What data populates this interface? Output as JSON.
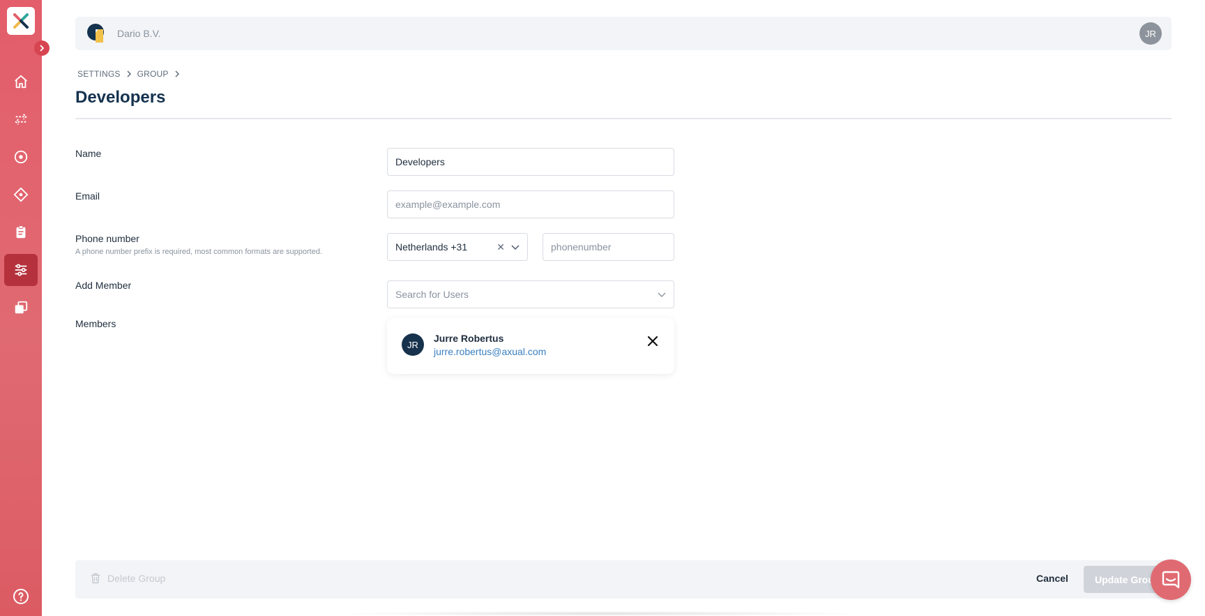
{
  "org": {
    "name": "Dario B.V."
  },
  "user": {
    "initials": "JR"
  },
  "sidebar": {
    "items": [
      {
        "icon": "home-icon",
        "active": false
      },
      {
        "icon": "transfer-icon",
        "active": false
      },
      {
        "icon": "target-icon",
        "active": false
      },
      {
        "icon": "diamond-icon",
        "active": false
      },
      {
        "icon": "clipboard-icon",
        "active": false
      },
      {
        "icon": "settings-sliders-icon",
        "active": true
      },
      {
        "icon": "copy-icon",
        "active": false
      }
    ]
  },
  "breadcrumb": [
    "SETTINGS",
    "GROUP"
  ],
  "page": {
    "title": "Developers"
  },
  "form": {
    "name_label": "Name",
    "name_value": "Developers",
    "email_label": "Email",
    "email_placeholder": "example@example.com",
    "email_value": "",
    "phone_label": "Phone number",
    "phone_hint": "A phone number prefix is required, most common formats are supported.",
    "phone_country": "Netherlands +31",
    "phone_placeholder": "phonenumber",
    "add_member_label": "Add Member",
    "add_member_placeholder": "Search for Users",
    "members_label": "Members"
  },
  "members": [
    {
      "initials": "JR",
      "name": "Jurre Robertus",
      "email": "jurre.robertus@axual.com"
    }
  ],
  "footer": {
    "delete_label": "Delete Group",
    "cancel_label": "Cancel",
    "update_label": "Update Group"
  },
  "colors": {
    "sidebar": "#e06a72",
    "active_nav": "#b5323d",
    "title": "#15324e",
    "link": "#3a7fc1"
  }
}
